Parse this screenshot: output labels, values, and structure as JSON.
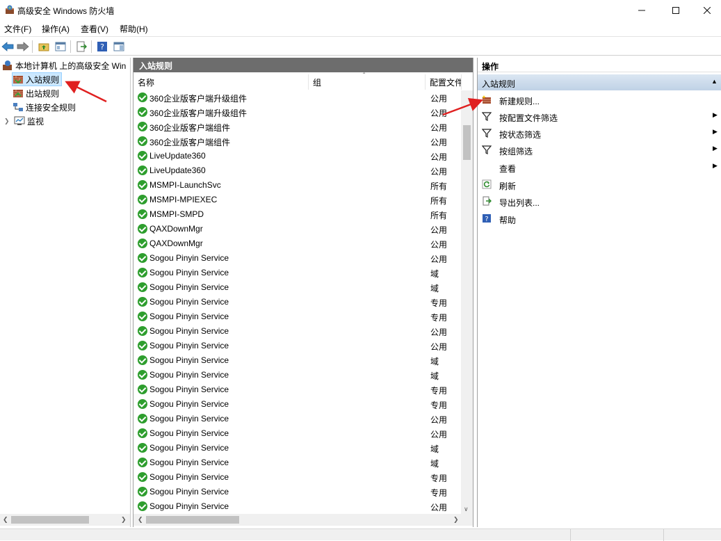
{
  "window": {
    "title": "高级安全 Windows 防火墙"
  },
  "menu": [
    {
      "label": "文件(F)"
    },
    {
      "label": "操作(A)"
    },
    {
      "label": "查看(V)"
    },
    {
      "label": "帮助(H)"
    }
  ],
  "tree": {
    "root": "本地计算机 上的高级安全 Win",
    "items": [
      {
        "label": "入站规则",
        "selected": true
      },
      {
        "label": "出站规则"
      },
      {
        "label": "连接安全规则"
      },
      {
        "label": "监视"
      }
    ]
  },
  "middle": {
    "title": "入站规则",
    "columns": [
      "名称",
      "组",
      "配置文件"
    ],
    "rows": [
      {
        "name": "360企业版客户端升级组件",
        "profile": "公用"
      },
      {
        "name": "360企业版客户端升级组件",
        "profile": "公用"
      },
      {
        "name": "360企业版客户端组件",
        "profile": "公用"
      },
      {
        "name": "360企业版客户端组件",
        "profile": "公用"
      },
      {
        "name": "LiveUpdate360",
        "profile": "公用"
      },
      {
        "name": "LiveUpdate360",
        "profile": "公用"
      },
      {
        "name": "MSMPI-LaunchSvc",
        "profile": "所有"
      },
      {
        "name": "MSMPI-MPIEXEC",
        "profile": "所有"
      },
      {
        "name": "MSMPI-SMPD",
        "profile": "所有"
      },
      {
        "name": "QAXDownMgr",
        "profile": "公用"
      },
      {
        "name": "QAXDownMgr",
        "profile": "公用"
      },
      {
        "name": "Sogou Pinyin Service",
        "profile": "公用"
      },
      {
        "name": "Sogou Pinyin Service",
        "profile": "域"
      },
      {
        "name": "Sogou Pinyin Service",
        "profile": "域"
      },
      {
        "name": "Sogou Pinyin Service",
        "profile": "专用"
      },
      {
        "name": "Sogou Pinyin Service",
        "profile": "专用"
      },
      {
        "name": "Sogou Pinyin Service",
        "profile": "公用"
      },
      {
        "name": "Sogou Pinyin Service",
        "profile": "公用"
      },
      {
        "name": "Sogou Pinyin Service",
        "profile": "域"
      },
      {
        "name": "Sogou Pinyin Service",
        "profile": "域"
      },
      {
        "name": "Sogou Pinyin Service",
        "profile": "专用"
      },
      {
        "name": "Sogou Pinyin Service",
        "profile": "专用"
      },
      {
        "name": "Sogou Pinyin Service",
        "profile": "公用"
      },
      {
        "name": "Sogou Pinyin Service",
        "profile": "公用"
      },
      {
        "name": "Sogou Pinyin Service",
        "profile": "域"
      },
      {
        "name": "Sogou Pinyin Service",
        "profile": "域"
      },
      {
        "name": "Sogou Pinyin Service",
        "profile": "专用"
      },
      {
        "name": "Sogou Pinyin Service",
        "profile": "专用"
      },
      {
        "name": "Sogou Pinyin Service",
        "profile": "公用"
      }
    ]
  },
  "actions": {
    "title": "操作",
    "section": "入站规则",
    "items": [
      {
        "label": "新建规则...",
        "icon": "new-rule-icon"
      },
      {
        "label": "按配置文件筛选",
        "icon": "filter-icon",
        "submenu": true
      },
      {
        "label": "按状态筛选",
        "icon": "filter-icon",
        "submenu": true
      },
      {
        "label": "按组筛选",
        "icon": "filter-icon",
        "submenu": true
      },
      {
        "label": "查看",
        "icon": "",
        "submenu": true
      },
      {
        "label": "刷新",
        "icon": "refresh-icon"
      },
      {
        "label": "导出列表...",
        "icon": "export-icon"
      },
      {
        "label": "帮助",
        "icon": "help-icon"
      }
    ]
  },
  "colors": {
    "check": "#2e9e2e",
    "header_bg": "#6d6d6d",
    "selected_bg": "#cce8ff",
    "annotation": "#e02020"
  }
}
